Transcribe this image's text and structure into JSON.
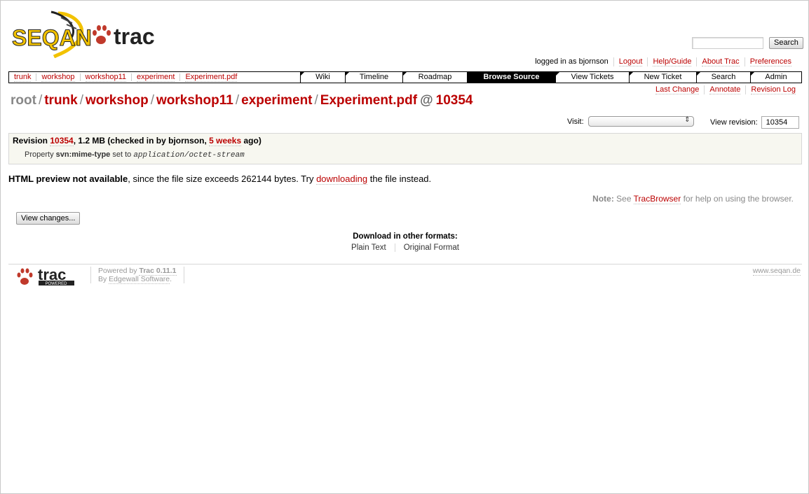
{
  "logo": {
    "text": "SEQAN",
    "trac": "trac"
  },
  "search": {
    "placeholder": "",
    "button": "Search"
  },
  "metanav": {
    "logged_in": "logged in as bjornson",
    "items": [
      "Logout",
      "Help/Guide",
      "About Trac",
      "Preferences"
    ]
  },
  "breadcrumbs": [
    "trunk",
    "workshop",
    "workshop11",
    "experiment",
    "Experiment.pdf"
  ],
  "mainnav": [
    {
      "label": "Wiki"
    },
    {
      "label": "Timeline"
    },
    {
      "label": "Roadmap"
    },
    {
      "label": "Browse Source",
      "active": true
    },
    {
      "label": "View Tickets"
    },
    {
      "label": "New Ticket"
    },
    {
      "label": "Search"
    },
    {
      "label": "Admin"
    }
  ],
  "ctxtnav": [
    "Last Change",
    "Annotate",
    "Revision Log"
  ],
  "path": {
    "root": "root",
    "segments": [
      "trunk",
      "workshop",
      "workshop11",
      "experiment",
      "Experiment.pdf"
    ],
    "at": "@",
    "revision": "10354"
  },
  "visit": {
    "label": "Visit:",
    "value": ""
  },
  "view_revision": {
    "label": "View revision:",
    "value": "10354"
  },
  "info": {
    "revision_label": "Revision",
    "revision": "10354",
    "size_text": ", 1.2 MB (checked in by bjornson, ",
    "age": "5 weeks",
    "age_suffix": " ago)",
    "property_label": "Property",
    "property_name": "svn:mime-type",
    "property_mid": "set to",
    "property_value": "application/octet-stream"
  },
  "preview": {
    "bold": "HTML preview not available",
    "text1": ", since the file size exceeds 262144 bytes. Try ",
    "link": "downloading",
    "text2": " the file instead."
  },
  "note": {
    "label": "Note:",
    "text1": " See ",
    "link": "TracBrowser",
    "text2": " for help on using the browser."
  },
  "view_changes_button": "View changes...",
  "download": {
    "title": "Download in other formats:",
    "formats": [
      "Plain Text",
      "Original Format"
    ]
  },
  "footer": {
    "powered_by": "Powered by ",
    "trac_version": "Trac 0.11.1",
    "by": "By ",
    "edgewall": "Edgewall Software",
    "period": ".",
    "site": "www.seqan.de",
    "logo_text": "trac",
    "logo_badge": "POWERED"
  },
  "colors": {
    "link": "#bb0000",
    "accent_yellow": "#f2c200",
    "nav_active": "#000000"
  }
}
